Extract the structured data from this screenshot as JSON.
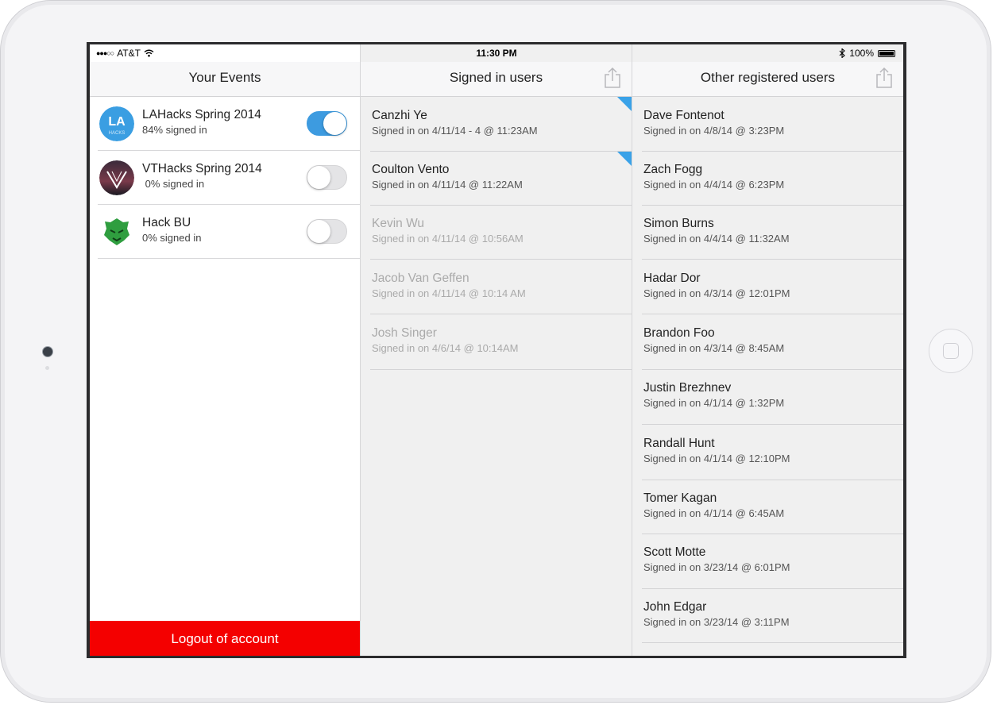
{
  "status_bar": {
    "carrier": "AT&T",
    "time": "11:30 PM",
    "battery": "100%"
  },
  "events_pane": {
    "title": "Your Events",
    "events": [
      {
        "name": "LAHacks Spring 2014",
        "status": "84% signed in",
        "enabled": true,
        "logo": "LA",
        "logo_sub": "HACKS"
      },
      {
        "name": "VTHacks Spring 2014",
        "status": " 0% signed in",
        "enabled": false
      },
      {
        "name": "Hack BU",
        "status": "0% signed in",
        "enabled": false
      }
    ],
    "logout_label": "Logout of account"
  },
  "signed_in_pane": {
    "title": "Signed in users",
    "users": [
      {
        "name": "Canzhi Ye",
        "detail": "Signed in on 4/11/14 - 4 @ 11:23AM",
        "flagged": true,
        "dim": false
      },
      {
        "name": "Coulton Vento",
        "detail": "Signed in on 4/11/14 @ 11:22AM",
        "flagged": true,
        "dim": false
      },
      {
        "name": "Kevin Wu",
        "detail": "Signed in on 4/11/14 @ 10:56AM",
        "flagged": false,
        "dim": true
      },
      {
        "name": "Jacob Van Geffen",
        "detail": "Signed in on 4/11/14 @ 10:14 AM",
        "flagged": false,
        "dim": true
      },
      {
        "name": "Josh Singer",
        "detail": "Signed in on 4/6/14 @ 10:14AM",
        "flagged": false,
        "dim": true
      }
    ]
  },
  "other_pane": {
    "title": "Other registered users",
    "users": [
      {
        "name": "Dave Fontenot",
        "detail": "Signed in on 4/8/14 @ 3:23PM"
      },
      {
        "name": "Zach Fogg",
        "detail": "Signed in on 4/4/14 @ 6:23PM"
      },
      {
        "name": "Simon Burns",
        "detail": "Signed in on 4/4/14 @ 11:32AM"
      },
      {
        "name": "Hadar Dor",
        "detail": "Signed in on 4/3/14 @ 12:01PM"
      },
      {
        "name": "Brandon Foo",
        "detail": "Signed in on 4/3/14 @ 8:45AM"
      },
      {
        "name": "Justin Brezhnev",
        "detail": "Signed in on 4/1/14 @ 1:32PM"
      },
      {
        "name": "Randall Hunt",
        "detail": "Signed in on 4/1/14 @ 12:10PM"
      },
      {
        "name": "Tomer Kagan",
        "detail": "Signed in on 4/1/14 @ 6:45AM"
      },
      {
        "name": "Scott Motte",
        "detail": "Signed in on 3/23/14 @ 6:01PM"
      },
      {
        "name": "John Edgar",
        "detail": "Signed in on 3/23/14 @ 3:11PM"
      }
    ]
  },
  "colors": {
    "accent": "#3d9be0",
    "logout": "#f40000",
    "flag": "#3aa2e8"
  }
}
